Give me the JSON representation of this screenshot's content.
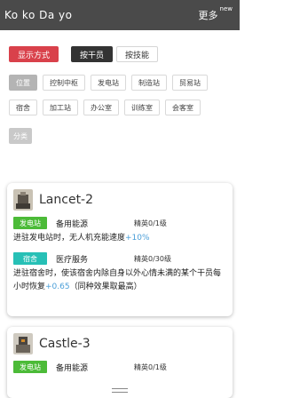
{
  "header": {
    "title": "Ko ko Da yo",
    "more_label": "更多",
    "more_badge": "new"
  },
  "modes": {
    "display_label": "显示方式",
    "by_operator_label": "按干员",
    "by_skill_label": "按技能"
  },
  "filters": [
    "位置",
    "控制中枢",
    "发电站",
    "制造站",
    "贸易站",
    "宿舍",
    "加工站",
    "办公室",
    "训练室",
    "会客室"
  ],
  "category_label": "分类",
  "cards": [
    {
      "name": "Lancet-2",
      "skills": [
        {
          "tag": "发电站",
          "tag_color": "#4cbb38",
          "name": "备用能源",
          "level": "精英0/1级",
          "desc_pre": "进驻发电站时，无人机充能速度",
          "desc_value": "+10%",
          "desc_post": ""
        },
        {
          "tag": "宿舍",
          "tag_color": "#27c0b6",
          "name": "医疗服务",
          "level": "精英0/30级",
          "desc_pre": "进驻宿舍时，使该宿舍内除自身以外心情未满的某个干员每小时恢复",
          "desc_value": "+0.65",
          "desc_post": "（同种效果取最高）"
        }
      ]
    },
    {
      "name": "Castle-3",
      "skills": [
        {
          "tag": "发电站",
          "tag_color": "#4cbb38",
          "name": "备用能源",
          "level": "精英0/1级"
        }
      ]
    }
  ]
}
